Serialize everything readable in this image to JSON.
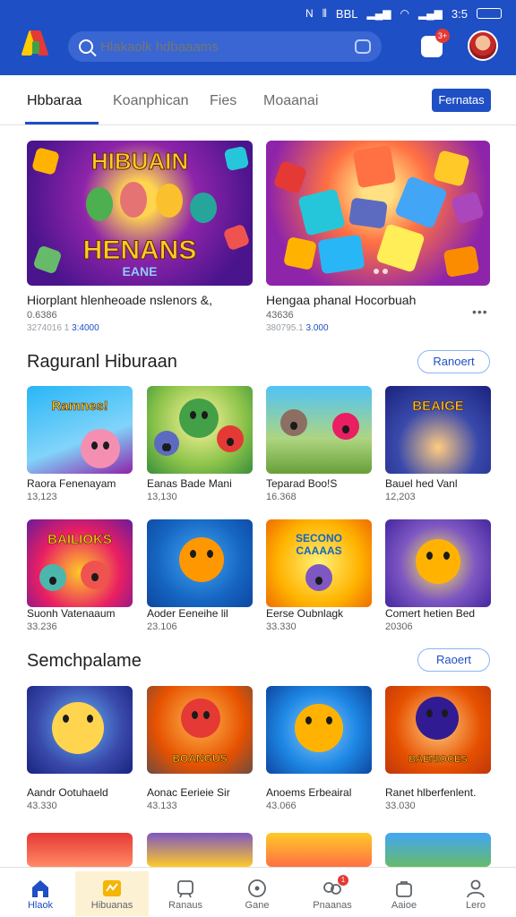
{
  "status": {
    "left_text": "BBL",
    "right_text": "3:5"
  },
  "search": {
    "placeholder": "Hlakaolk hdbaaams"
  },
  "notif": {
    "badge": "3+"
  },
  "tabs": [
    {
      "label": "Hbbaraa",
      "active": true
    },
    {
      "label": "Koanphican"
    },
    {
      "label": "Fies"
    },
    {
      "label": "Moaanai"
    }
  ],
  "tab_action": "Fernatas",
  "featured": [
    {
      "art_title": "HIBUAIN",
      "art_sub": "HENANS",
      "art_tag": "EANE",
      "title": "Hiorplant hlenheoade nslenors &,",
      "sub": "0.6386",
      "meta_left": "3274016 1",
      "meta_right": "3:4000"
    },
    {
      "title": "Hengaa phanal Hocorbuah",
      "sub": "43636",
      "meta_left": "380795.1",
      "meta_right": "3.000"
    }
  ],
  "section1": {
    "title": "Raguranl Hiburaan",
    "action": "Ranoert",
    "items": [
      {
        "banner": "Ramnes!",
        "name": "Raora Fenenayam",
        "count": "13,123"
      },
      {
        "banner": "",
        "name": "Eanas Bade Mani",
        "count": "13,130"
      },
      {
        "banner": "",
        "name": "Teparad Boo!S",
        "count": "16.368"
      },
      {
        "banner": "BEAIGE",
        "name": "Bauel hed Vanl",
        "count": "12,203"
      },
      {
        "banner": "BAILIOKS",
        "name": "Suonh Vatenaaum",
        "count": "33.236"
      },
      {
        "banner": "",
        "name": "Aoder Eeneihe lil",
        "count": "23.106"
      },
      {
        "banner": "SECONO CAAAAS",
        "name": "Eerse Oubnlagk",
        "count": "33.330"
      },
      {
        "banner": "",
        "name": "Comert hetien Bed",
        "count": "20306"
      }
    ]
  },
  "section2": {
    "title": "Semchpalame",
    "action": "Raoert",
    "items": [
      {
        "banner": "",
        "name": "Aandr Ootuhaeld",
        "count": "43.330"
      },
      {
        "banner": "BOANGUS",
        "name": "Aonac Eerieie Sir",
        "count": "43.133"
      },
      {
        "banner": "",
        "name": "Anoems Erbeairal",
        "count": "43.066"
      },
      {
        "banner": "BAENIOCES",
        "name": "Ranet hlberfenlent.",
        "count": "33.030"
      }
    ]
  },
  "nav": [
    {
      "label": "Hlaok",
      "icon": "home-icon",
      "active": true
    },
    {
      "label": "Hibuanas",
      "icon": "games-icon",
      "highlight": true
    },
    {
      "label": "Ranaus",
      "icon": "ranking-icon"
    },
    {
      "label": "Gane",
      "icon": "disc-icon"
    },
    {
      "label": "Pnaanas",
      "icon": "community-icon",
      "badge": "1"
    },
    {
      "label": "Aaioe",
      "icon": "bag-icon"
    },
    {
      "label": "Lero",
      "icon": "person-icon"
    }
  ],
  "colors": {
    "brand": "#1f4fc4",
    "accent_yellow": "#ffca28"
  }
}
